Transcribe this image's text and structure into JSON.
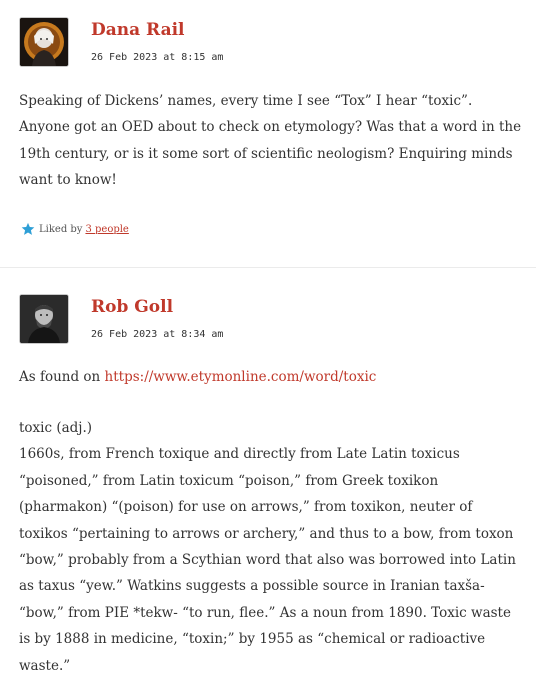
{
  "comments": [
    {
      "author": "Dana Rail",
      "timestamp": "26 Feb 2023 at 8:15 am",
      "avatar_icon": "user-avatar-icon",
      "lines": [
        "Speaking of Dickens’ names, every time I see “Tox” I hear “toxic”.",
        "Anyone got an OED about to check on etymology? Was that a word in the",
        "19th century, or is it some sort of scientific neologism? Enquiring minds",
        "want to know!"
      ],
      "liked_by_prefix": "Liked by",
      "liked_by_link": "3 people"
    },
    {
      "author": "Rob Goll",
      "timestamp": "26 Feb 2023 at 8:34 am",
      "avatar_icon": "user-avatar-icon",
      "intro_prefix": "As found on ",
      "intro_link": "https://www.etymonline.com/word/toxic",
      "lines": [
        "toxic (adj.)",
        "1660s, from French toxique and directly from Late Latin toxicus",
        "“poisoned,” from Latin toxicum “poison,” from Greek toxikon",
        "(pharmakon) “(poison) for use on arrows,” from toxikon, neuter of",
        "toxikos “pertaining to arrows or archery,” and thus to a bow, from toxon",
        "“bow,” probably from a Scythian word that also was borrowed into Latin",
        "as taxus “yew.” Watkins suggests a possible source in Iranian taxša-",
        "“bow,” from PIE *tekw- “to run, flee.” As a noun from 1890. Toxic waste",
        "is by 1888 in medicine, “toxin;” by 1955 as “chemical or radioactive",
        "waste.”"
      ]
    }
  ],
  "colors": {
    "accent": "#c0392b",
    "text": "#333333",
    "star": "#2e9fd6"
  }
}
